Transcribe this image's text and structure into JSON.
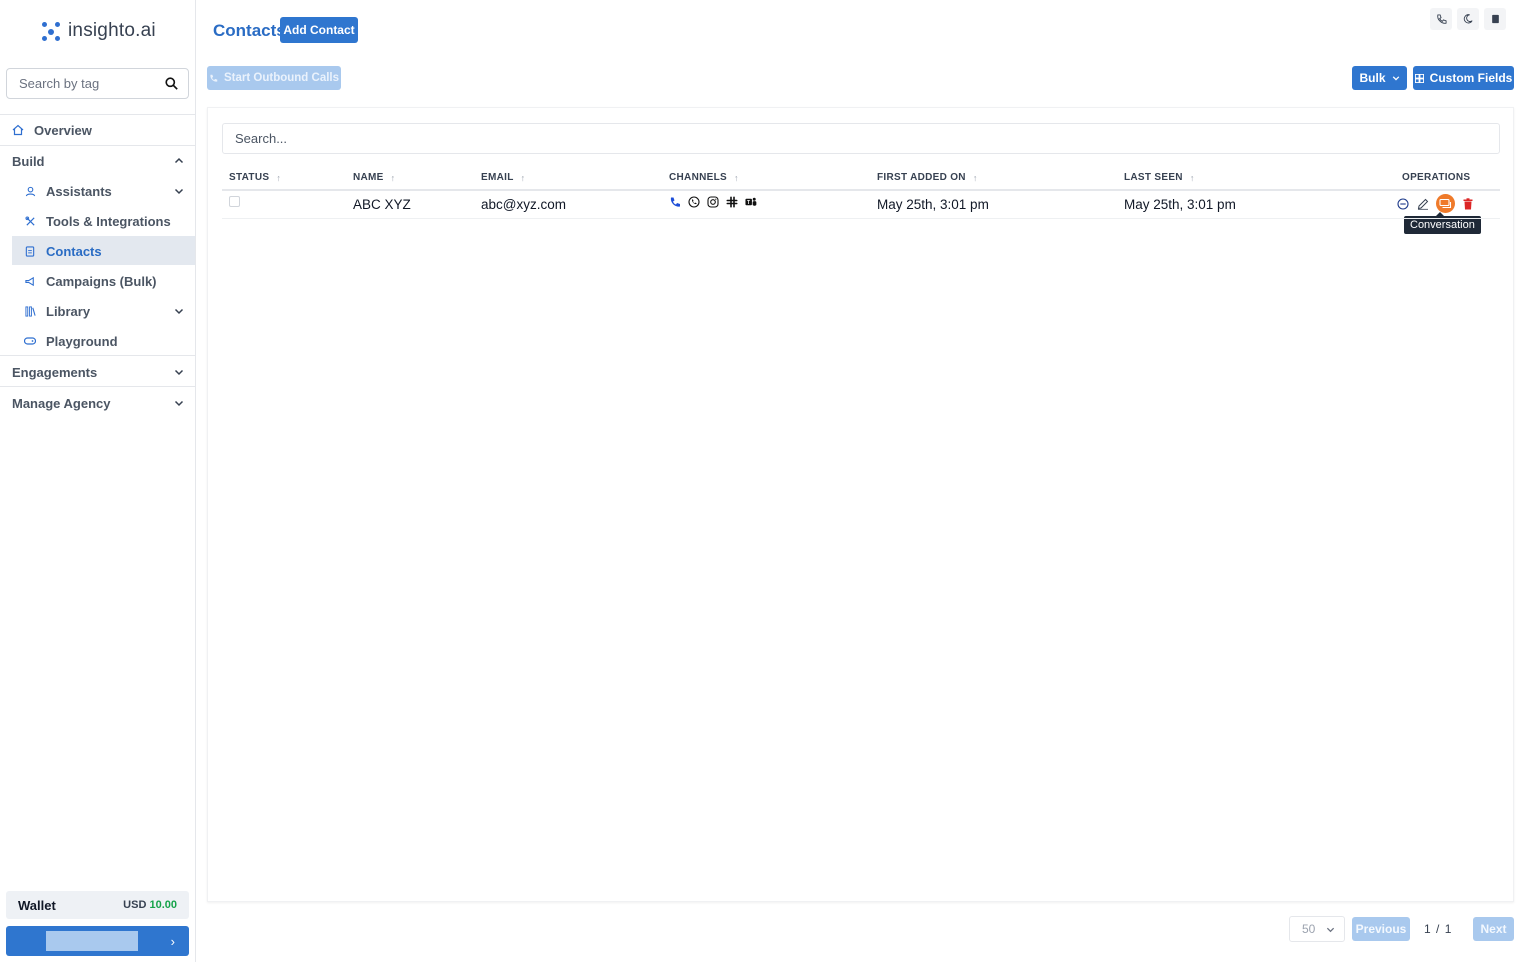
{
  "brand": {
    "name": "insighto.ai"
  },
  "sidebar": {
    "search_placeholder": "Search by tag",
    "overview": "Overview",
    "build": "Build",
    "items": [
      {
        "label": "Assistants",
        "icon": "user-icon",
        "expandable": true
      },
      {
        "label": "Tools & Integrations",
        "icon": "tools-icon",
        "expandable": false
      },
      {
        "label": "Contacts",
        "icon": "contacts-icon",
        "expandable": false,
        "active": true
      },
      {
        "label": "Campaigns (Bulk)",
        "icon": "megaphone-icon",
        "expandable": false
      },
      {
        "label": "Library",
        "icon": "library-icon",
        "expandable": true
      },
      {
        "label": "Playground",
        "icon": "gamepad-icon",
        "expandable": false
      }
    ],
    "engagements": "Engagements",
    "manage_agency": "Manage Agency",
    "wallet": {
      "label": "Wallet",
      "currency": "USD",
      "amount": "10.00"
    }
  },
  "header": {
    "title": "Contacts",
    "add_contact": "Add Contact",
    "start_outbound": "Start Outbound Calls",
    "bulk": "Bulk",
    "custom_fields": "Custom Fields",
    "top_icons": [
      "phone-icon",
      "moon-icon",
      "book-icon"
    ]
  },
  "table": {
    "search_placeholder": "Search...",
    "columns": [
      "STATUS",
      "NAME",
      "EMAIL",
      "CHANNELS",
      "FIRST ADDED ON",
      "LAST SEEN",
      "OPERATIONS"
    ],
    "rows": [
      {
        "name": "ABC XYZ",
        "email": "abc@xyz.com",
        "channels": [
          "phone-icon",
          "whatsapp-icon",
          "instagram-icon",
          "slack-icon",
          "teams-icon"
        ],
        "first_added": "May 25th, 3:01 pm",
        "last_seen": "May 25th, 3:01 pm",
        "operations": [
          "block-icon",
          "edit-icon",
          "conversation-icon",
          "delete-icon"
        ]
      }
    ],
    "tooltip": "Conversation"
  },
  "pagination": {
    "page_size": "50",
    "previous": "Previous",
    "current": "1",
    "separator": "/",
    "total": "1",
    "next": "Next"
  },
  "colors": {
    "primary": "#2f76cf",
    "primary_disabled": "#a9c9ee",
    "title": "#2a6cc4",
    "wallet_amount": "#16a34a",
    "conversation_highlight": "#ef7a2a",
    "delete": "#dc2626"
  }
}
